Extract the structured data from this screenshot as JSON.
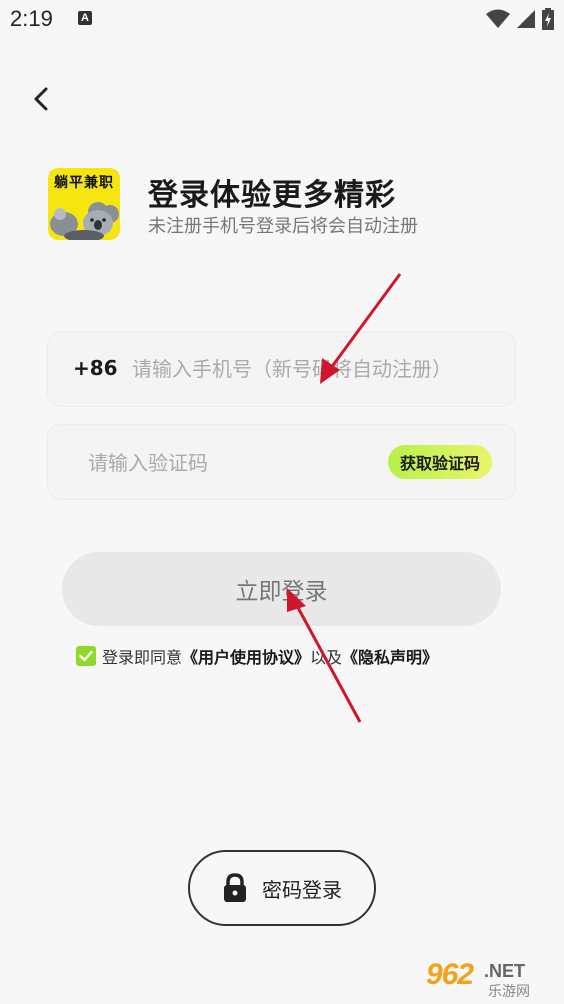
{
  "status_bar": {
    "time": "2:19",
    "notif_letter": "A"
  },
  "header": {
    "title": "登录体验更多精彩",
    "subtitle": "未注册手机号登录后将会自动注册"
  },
  "logo": {
    "text": "躺平兼职",
    "bg_color": "#f5e612"
  },
  "phone_field": {
    "country_code": "+86",
    "placeholder": "请输入手机号（新号码将自动注册）"
  },
  "code_field": {
    "placeholder": "请输入验证码",
    "get_code_label": "获取验证码"
  },
  "login_button": {
    "label": "立即登录"
  },
  "agreement": {
    "prefix": "登录即同意",
    "user_agreement": "《用户使用协议》",
    "joiner": "以及",
    "privacy": "《隐私声明》",
    "checked": true
  },
  "password_login": {
    "label": "密码登录"
  },
  "watermark": {
    "brand": "962",
    "domain": ".NET",
    "sub": "乐游网"
  },
  "colors": {
    "accent_green": "#8fd92a",
    "annotation_red": "#d0162b"
  }
}
